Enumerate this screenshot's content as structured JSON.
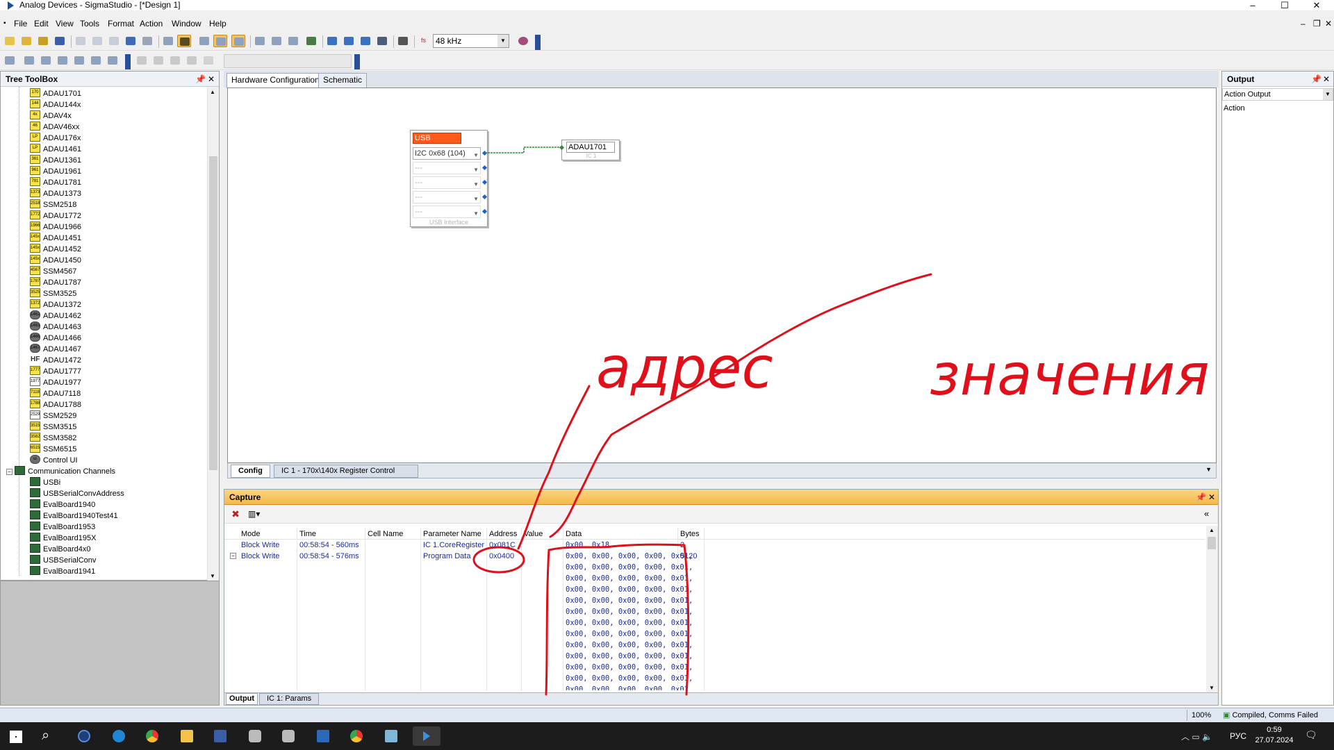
{
  "window": {
    "title": "Analog Devices - SigmaStudio - [*Design 1]"
  },
  "menu": [
    "File",
    "Edit",
    "View",
    "Tools",
    "Format",
    "Action",
    "Window",
    "Help"
  ],
  "toolbar": {
    "sample_rate": "48 kHz",
    "fs_label": "fs"
  },
  "tree_toolbox": {
    "title": "Tree ToolBox",
    "items": [
      {
        "label": "ADAU1701",
        "icon": "170"
      },
      {
        "label": "ADAU144x",
        "icon": "144"
      },
      {
        "label": "ADAV4x",
        "icon": "4x"
      },
      {
        "label": "ADAV46xx",
        "icon": "46"
      },
      {
        "label": "ADAU176x",
        "icon": "LP"
      },
      {
        "label": "ADAU1461",
        "icon": "LP"
      },
      {
        "label": "ADAU1361",
        "icon": "361"
      },
      {
        "label": "ADAU1961",
        "icon": "961"
      },
      {
        "label": "ADAU1781",
        "icon": "781"
      },
      {
        "label": "ADAU1373",
        "icon": "1373"
      },
      {
        "label": "SSM2518",
        "icon": "2518"
      },
      {
        "label": "ADAU1772",
        "icon": "1772"
      },
      {
        "label": "ADAU1966",
        "icon": "1966"
      },
      {
        "label": "ADAU1451",
        "icon": "145x"
      },
      {
        "label": "ADAU1452",
        "icon": "145x"
      },
      {
        "label": "ADAU1450",
        "icon": "145x"
      },
      {
        "label": "SSM4567",
        "icon": "4567"
      },
      {
        "label": "ADAU1787",
        "icon": "1787"
      },
      {
        "label": "SSM3525",
        "icon": "3525"
      },
      {
        "label": "ADAU1372",
        "icon": "1372"
      },
      {
        "label": "ADAU1462",
        "icon": "1462"
      },
      {
        "label": "ADAU1463",
        "icon": "1463"
      },
      {
        "label": "ADAU1466",
        "icon": "1466"
      },
      {
        "label": "ADAU1467",
        "icon": "1467"
      },
      {
        "label": "ADAU1472",
        "icon": "HF"
      },
      {
        "label": "ADAU1777",
        "icon": "1777"
      },
      {
        "label": "ADAU1977",
        "icon": "1977"
      },
      {
        "label": "ADAU7118",
        "icon": "7118"
      },
      {
        "label": "ADAU1788",
        "icon": "1788"
      },
      {
        "label": "SSM2529",
        "icon": "2529"
      },
      {
        "label": "SSM3515",
        "icon": "3515"
      },
      {
        "label": "SSM3582",
        "icon": "3582"
      },
      {
        "label": "SSM6515",
        "icon": "6515"
      },
      {
        "label": "Control UI",
        "icon": "ui"
      }
    ],
    "group": "Communication Channels",
    "channels": [
      "USBi",
      "USBSerialConvAddress",
      "EvalBoard1940",
      "EvalBoard1940Test41",
      "EvalBoard1953",
      "EvalBoard195X",
      "EvalBoard4x0",
      "USBSerialConv",
      "EvalBoard1941"
    ]
  },
  "doc_tabs": [
    "Hardware Configuration",
    "Schematic"
  ],
  "usb_block": {
    "title": "USB",
    "selected": "I2C 0x68 (104)",
    "empty": "---",
    "footer": "USB Interface"
  },
  "ic_block": {
    "name": "ADAU1701",
    "footer": "IC 1"
  },
  "bottom_tabs": [
    "Config",
    "IC 1 - 170x\\140x Register Control"
  ],
  "capture": {
    "title": "Capture",
    "columns": [
      "Mode",
      "Time",
      "Cell Name",
      "Parameter Name",
      "Address",
      "Value",
      "Data",
      "Bytes"
    ],
    "rows": [
      {
        "mode": "Block Write",
        "time": "00:58:54 - 560ms",
        "cell": "",
        "param": "IC 1.CoreRegister",
        "address": "0x081C",
        "value": "",
        "data": "0x00, 0x18",
        "bytes": "2"
      },
      {
        "mode": "Block Write",
        "time": "00:58:54 - 576ms",
        "cell": "",
        "param": "Program Data",
        "address": "0x0400",
        "value": "",
        "data": "0x00, 0x00, 0x00, 0x00, 0x01,",
        "bytes": "5120"
      }
    ],
    "data_cont": [
      "0x00, 0x00, 0x00, 0x00, 0x01,",
      "0x00, 0x00, 0x00, 0x00, 0x01,",
      "0x00, 0x00, 0x00, 0x00, 0x01,",
      "0x00, 0x00, 0x00, 0x00, 0x01,",
      "0x00, 0x00, 0x00, 0x00, 0x01,",
      "0x00, 0x00, 0x00, 0x00, 0x01,",
      "0x00, 0x00, 0x00, 0x00, 0x01,",
      "0x00, 0x00, 0x00, 0x00, 0x01,",
      "0x00, 0x00, 0x00, 0x00, 0x01,",
      "0x00, 0x00, 0x00, 0x00, 0x01,",
      "0x00, 0x00, 0x00, 0x00, 0x01,",
      "0x00, 0x00, 0x00, 0x00, 0x01,"
    ],
    "bottom_tabs": [
      "Output",
      "IC 1: Params"
    ]
  },
  "output_panel": {
    "title": "Output",
    "dropdown": "Action Output",
    "column": "Action"
  },
  "annotations": {
    "address": "адрес",
    "values": "значения"
  },
  "status": {
    "zoom": "100%",
    "state": "Compiled, Comms Failed"
  },
  "taskbar": {
    "lang": "РУС",
    "time": "0:59",
    "date": "27.07.2024"
  },
  "colors": {
    "accent": "#f5b84c",
    "usb": "#ff5a1a",
    "annotation": "#e0101a",
    "link": "#1a2aa0"
  }
}
